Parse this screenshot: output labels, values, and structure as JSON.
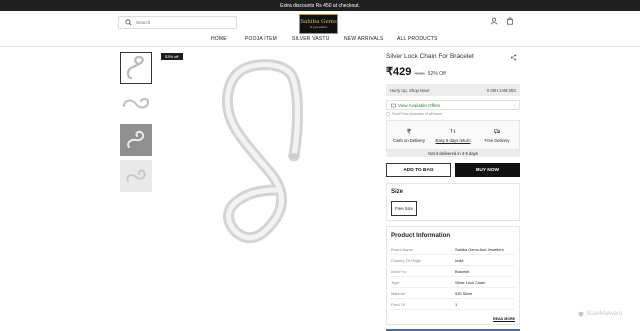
{
  "announcement": "Extra discounts Rs 450 at checkout.",
  "header": {
    "search_placeholder": "Search",
    "logo_line1": "Sahiba Gems",
    "logo_line2": "& Jewellers"
  },
  "nav": [
    "HOME",
    "POOJA ITEM",
    "SILVER VASTU",
    "NEW ARRIVALS",
    "ALL PRODUCTS"
  ],
  "product": {
    "badge": "53% off",
    "title": "Silver Lock Chain For Bracelet",
    "price": "₹429",
    "mrp": "₹909",
    "discount": "52% Off",
    "hurry": "Hurry Up, Shop Now!",
    "timer": "0 00H:14M:38S",
    "offers_label": "View Available Offers",
    "tax_note": "Final Price (inclusive of all taxes",
    "features": [
      {
        "label": "Cash on Delivery",
        "icon": "rupee-icon"
      },
      {
        "label": "Easy 5 days return",
        "icon": "return-icon"
      },
      {
        "label": "Free Delivery",
        "icon": "truck-icon"
      }
    ],
    "delivery_note": "Get it delivered in 4-5 days",
    "add_to_bag": "ADD TO BAG",
    "buy_now": "BUY NOW",
    "size_title": "Size",
    "size_option": "Free Size",
    "info_title": "Product Information",
    "info_rows": [
      {
        "k": "Brand Name",
        "v": "Sahiba Gems And Jewellers"
      },
      {
        "k": "Country Of Origin",
        "v": "India"
      },
      {
        "k": "Ideal For",
        "v": "Bracelet"
      },
      {
        "k": "Type",
        "v": "Silver Lock Chain"
      },
      {
        "k": "Material",
        "v": "925 Silver"
      },
      {
        "k": "Pack Of",
        "v": "1"
      }
    ],
    "read_more": "READ MORE"
  },
  "watermark": "ScanMalware",
  "colors": {
    "offers": "#2e7d32",
    "dark": "#111111",
    "accent_strip": "#3d6fb3"
  }
}
